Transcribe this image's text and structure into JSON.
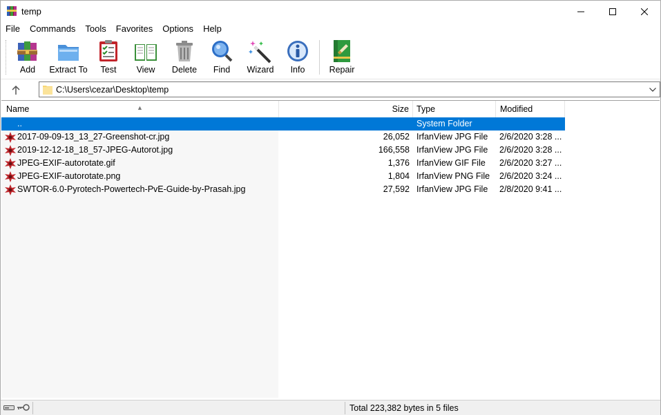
{
  "window": {
    "title": "temp"
  },
  "menu": [
    "File",
    "Commands",
    "Tools",
    "Favorites",
    "Options",
    "Help"
  ],
  "toolbar": {
    "add": "Add",
    "extract": "Extract To",
    "test": "Test",
    "view": "View",
    "delete": "Delete",
    "find": "Find",
    "wizard": "Wizard",
    "info": "Info",
    "repair": "Repair"
  },
  "address": {
    "path": "C:\\Users\\cezar\\Desktop\\temp"
  },
  "columns": {
    "name": "Name",
    "size": "Size",
    "type": "Type",
    "modified": "Modified"
  },
  "files": [
    {
      "name": "..",
      "size": "",
      "type": "System Folder",
      "modified": "",
      "icon": "parent-folder-icon"
    },
    {
      "name": "2017-09-09-13_13_27-Greenshot-cr.jpg",
      "size": "26,052",
      "type": "IrfanView JPG File",
      "modified": "2/6/2020 3:28 ...",
      "icon": "irfanview-file-icon"
    },
    {
      "name": "2019-12-12-18_18_57-JPEG-Autorot.jpg",
      "size": "166,558",
      "type": "IrfanView JPG File",
      "modified": "2/6/2020 3:28 ...",
      "icon": "irfanview-file-icon"
    },
    {
      "name": "JPEG-EXIF-autorotate.gif",
      "size": "1,376",
      "type": "IrfanView GIF File",
      "modified": "2/6/2020 3:27 ...",
      "icon": "irfanview-file-icon"
    },
    {
      "name": "JPEG-EXIF-autorotate.png",
      "size": "1,804",
      "type": "IrfanView PNG File",
      "modified": "2/6/2020 3:24 ...",
      "icon": "irfanview-file-icon"
    },
    {
      "name": "SWTOR-6.0-Pyrotech-Powertech-PvE-Guide-by-Prasah.jpg",
      "size": "27,592",
      "type": "IrfanView JPG File",
      "modified": "2/8/2020 9:41 ...",
      "icon": "irfanview-file-icon"
    }
  ],
  "status": {
    "text": "Total 223,382 bytes in 5 files"
  },
  "colors": {
    "selection": "#0078d7"
  }
}
